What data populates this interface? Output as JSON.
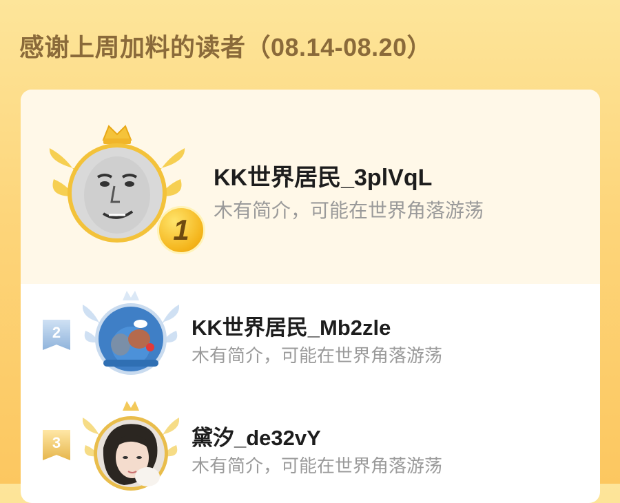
{
  "header": {
    "title": "感谢上周加料的读者（08.14-08.20）"
  },
  "readers": [
    {
      "rank": "1",
      "name": "KK世界居民_3plVqL",
      "bio": "木有简介，可能在世界角落游荡"
    },
    {
      "rank": "2",
      "name": "KK世界居民_Mb2zle",
      "bio": "木有简介，可能在世界角落游荡"
    },
    {
      "rank": "3",
      "name": "黛汐_de32vY",
      "bio": "木有简介，可能在世界角落游荡"
    }
  ],
  "colors": {
    "gold": "#f4b41a",
    "silver": "#8fb3db",
    "bronze": "#e6b64c",
    "title": "#8a6a3a"
  },
  "icons": [
    "crown-icon",
    "laurel-wings-icon",
    "rank-medal-icon",
    "rank-ribbon-icon"
  ]
}
